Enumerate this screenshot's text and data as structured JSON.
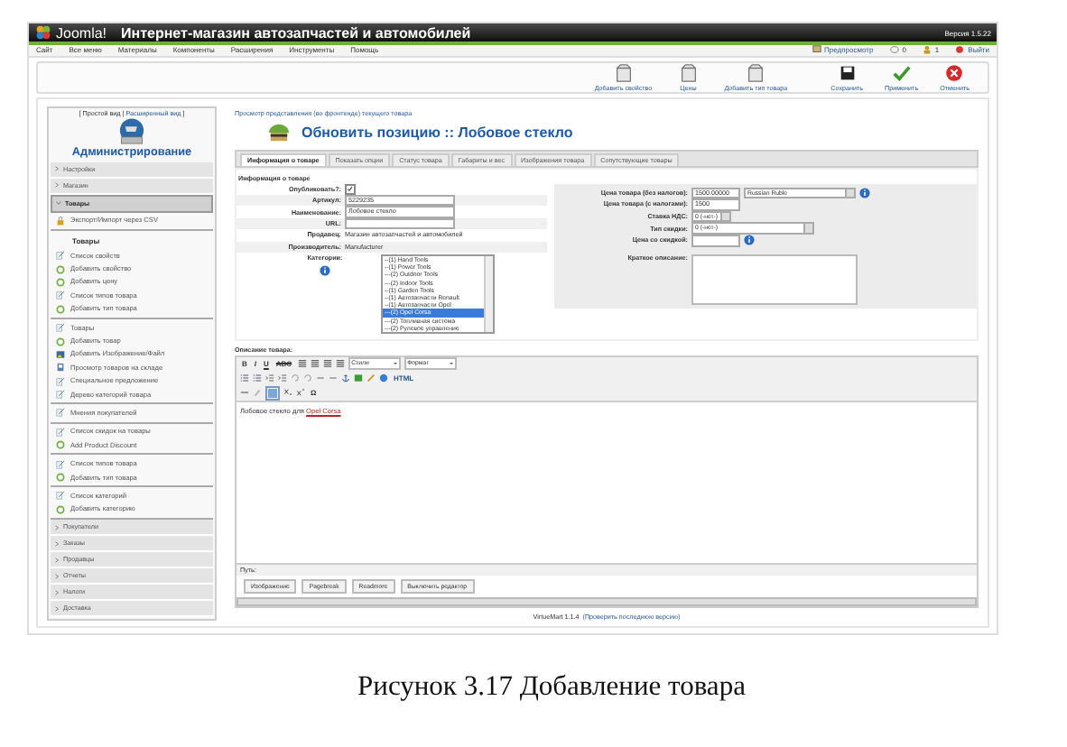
{
  "header": {
    "logo_text": "Joomla!",
    "title": "Интернет-магазин автозапчастей и автомобилей",
    "version": "Версия 1.5.22"
  },
  "menu": {
    "items": [
      "Сайт",
      "Все меню",
      "Материалы",
      "Компоненты",
      "Расширения",
      "Инструменты",
      "Помощь"
    ],
    "preview": "Предпросмотр",
    "messages": "0",
    "users": "1",
    "logout": "Выйти"
  },
  "toolbar": [
    {
      "label": "Добавить свойство",
      "kind": "box"
    },
    {
      "label": "Цены",
      "kind": "box"
    },
    {
      "label": "Добавить тип товара",
      "kind": "box"
    },
    {
      "label": "Сохранить",
      "kind": "save"
    },
    {
      "label": "Применить",
      "kind": "apply"
    },
    {
      "label": "Отменить",
      "kind": "cancel"
    }
  ],
  "sidebar": {
    "view_before": "[ Простой вид |",
    "view_link": "Расширенный вид",
    "view_after": "]",
    "title": "Администрирование",
    "sections_top": [
      {
        "label": "Настройки",
        "expanded": false
      },
      {
        "label": "Магазин",
        "expanded": false
      },
      {
        "label": "Товары",
        "expanded": true
      }
    ],
    "groups": [
      {
        "items": [
          {
            "label": "Экспорт/Импорт через CSV",
            "kind": "csv"
          }
        ]
      },
      {
        "heading": "Товары",
        "items": [
          {
            "label": "Список свойств",
            "kind": "list"
          },
          {
            "label": "Добавить свойство",
            "kind": "add"
          },
          {
            "label": "Добавить цену",
            "kind": "add"
          },
          {
            "label": "Список типов товара",
            "kind": "list"
          },
          {
            "label": "Добавить тип товара",
            "kind": "add"
          }
        ]
      },
      {
        "items": [
          {
            "label": "Товары",
            "kind": "list"
          },
          {
            "label": "Добавить товар",
            "kind": "add"
          },
          {
            "label": "Добавить Изображение/Файл",
            "kind": "image"
          },
          {
            "label": "Просмотр товаров на складе",
            "kind": "stock"
          },
          {
            "label": "Специальное предложение",
            "kind": "list"
          },
          {
            "label": "Дерево категорий товара",
            "kind": "list"
          }
        ]
      },
      {
        "items": [
          {
            "label": "Мнения покупателей",
            "kind": "list"
          }
        ]
      },
      {
        "items": [
          {
            "label": "Список скидок на товары",
            "kind": "list"
          },
          {
            "label": "Add Product Discount",
            "kind": "add"
          }
        ]
      },
      {
        "items": [
          {
            "label": "Список типов товара",
            "kind": "list"
          },
          {
            "label": "Добавить тип товара",
            "kind": "add"
          }
        ]
      },
      {
        "items": [
          {
            "label": "Список категорий",
            "kind": "list"
          },
          {
            "label": "Добавить категорию",
            "kind": "add"
          }
        ]
      }
    ],
    "sections_bottom": [
      {
        "label": "Покупатели",
        "expanded": false
      },
      {
        "label": "Заказы",
        "expanded": false
      },
      {
        "label": "Продавцы",
        "expanded": false
      },
      {
        "label": "Отчеты",
        "expanded": false
      },
      {
        "label": "Налоги",
        "expanded": false
      },
      {
        "label": "Доставка",
        "expanded": false
      }
    ]
  },
  "main": {
    "breadcrumb": "Просмотр представления (во фронтенде) текущего товара",
    "title": "Обновить позицию :: Лобовое стекло",
    "tabs": [
      {
        "label": "Информация о товаре",
        "selected": true
      },
      {
        "label": "Показать опции",
        "selected": false
      },
      {
        "label": "Статус товара",
        "selected": false
      },
      {
        "label": "Габариты и вес",
        "selected": false
      },
      {
        "label": "Изображения товара",
        "selected": false
      },
      {
        "label": "Сопутствующие товары",
        "selected": false
      }
    ],
    "section_title": "Информация о товаре",
    "left_fields": [
      {
        "label": "Опубликовать?:",
        "kind": "checkbox",
        "checked": true
      },
      {
        "label": "Артикул:",
        "kind": "input",
        "value": "5229235"
      },
      {
        "label": "Наименование:",
        "kind": "input",
        "value": "Лобовое стекло"
      },
      {
        "label": "URL:",
        "kind": "input"
      },
      {
        "label": "Продавец:",
        "kind": "text",
        "value": "Магазин автозапчастей и автомобилей"
      },
      {
        "label": "Производитель:",
        "kind": "text",
        "value": "Manufacturer"
      }
    ],
    "categories": {
      "label": "Категории:",
      "options": [
        {
          "label": "--(1) Hand Tools",
          "selected": false
        },
        {
          "label": "--(1) Power Tools",
          "selected": false
        },
        {
          "label": "---(2) Outdoor Tools",
          "selected": false
        },
        {
          "label": "---(2) Indoor Tools",
          "selected": false
        },
        {
          "label": "--(1) Garden Tools",
          "selected": false
        },
        {
          "label": "--(1) Автозапчасти Renault",
          "selected": false
        },
        {
          "label": "--(1) Автозапчасти Opel",
          "selected": false
        },
        {
          "label": "---(2) Opel Corsa",
          "selected": true
        },
        {
          "label": "---(2) Топливная система",
          "selected": false
        },
        {
          "label": "---(2) Рулевое управление",
          "selected": false
        }
      ]
    },
    "right_fields": [
      {
        "label": "Цена товара (без налогов):",
        "kind": "price",
        "value": "1500.00000",
        "select": "Russian Ruble",
        "info": true
      },
      {
        "label": "Цена товара (с налогами):",
        "kind": "input",
        "value": "1500"
      },
      {
        "label": "Ставка НДС:",
        "kind": "select",
        "value": "0 (-нет-)"
      },
      {
        "label": "Тип скидки:",
        "kind": "selectwide",
        "value": "0 (-нет-)"
      },
      {
        "label": "Цена со скидкой:",
        "kind": "input",
        "info": true
      }
    ],
    "short_description_label": "Краткое описание:",
    "description_label": "Описание товара:",
    "editor": {
      "format_buttons": [
        "B",
        "I",
        "U",
        "ABC"
      ],
      "styles": "Стили",
      "format": "Формат",
      "html": "HTML",
      "omega": "Ω",
      "content_before": "Лобовое стекло для ",
      "content_link": "Opel Corsa",
      "path_label": "Путь:",
      "buttons": [
        "Изображение",
        "Pagebreak",
        "Readmore",
        "Выключить редактор"
      ]
    },
    "footer_version": "VirtueMart 1.1.4",
    "footer_link": "(Проверить последнюю версию)"
  },
  "caption": "Рисунок 3.17 Добавление товара"
}
